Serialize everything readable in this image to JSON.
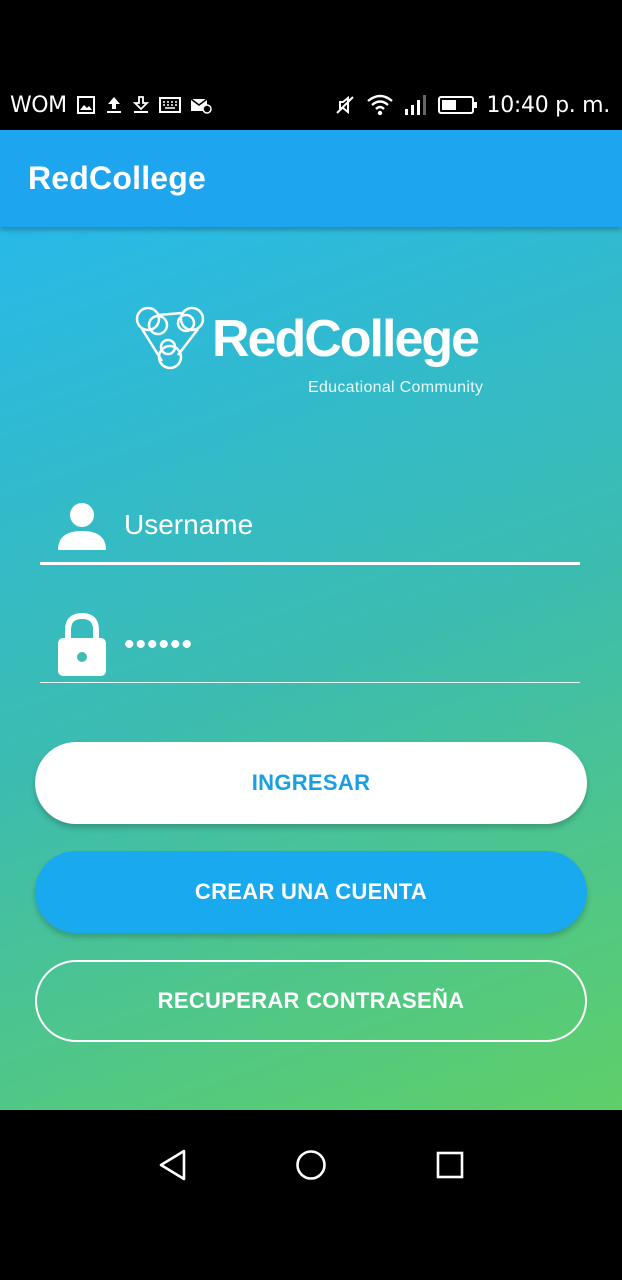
{
  "status_bar": {
    "carrier": "WOM",
    "time": "10:40 p. m.",
    "left_icons": [
      "image-icon",
      "upload-icon",
      "download-icon",
      "keyboard-icon",
      "mail-off-icon"
    ],
    "right_icons": [
      "mute-icon",
      "wifi-icon",
      "signal-icon",
      "battery-icon"
    ]
  },
  "app_bar": {
    "title": "RedCollege"
  },
  "logo": {
    "name": "RedCollege",
    "tagline": "Educational Community"
  },
  "form": {
    "username": {
      "placeholder": "Username",
      "value": ""
    },
    "password": {
      "value": "••••••"
    }
  },
  "buttons": {
    "login": "INGRESAR",
    "create_account": "CREAR UNA CUENTA",
    "recover_password": "RECUPERAR CONTRASEÑA"
  },
  "nav": {
    "back": "back-icon",
    "home": "home-icon",
    "recents": "recents-icon"
  },
  "colors": {
    "app_bar": "#1ea5ef",
    "gradient_top": "#28b9e8",
    "gradient_bottom": "#5fcf68",
    "login_text": "#1a9fe4",
    "create_bg": "#19a9ef"
  }
}
